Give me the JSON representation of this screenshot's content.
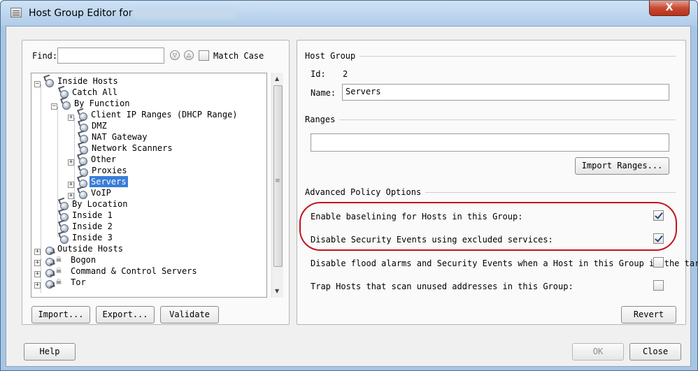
{
  "window": {
    "title": "Host Group Editor for",
    "close_label": "X"
  },
  "left": {
    "find_label": "Find:",
    "find_value": "",
    "match_case_label": "Match Case",
    "tree": [
      {
        "label": "Inside Hosts"
      },
      {
        "label": "Catch All"
      },
      {
        "label": "By Function"
      },
      {
        "label": "Client IP Ranges (DHCP Range)"
      },
      {
        "label": "DMZ"
      },
      {
        "label": "NAT Gateway"
      },
      {
        "label": "Network Scanners"
      },
      {
        "label": "Other"
      },
      {
        "label": "Proxies"
      },
      {
        "label": "Servers"
      },
      {
        "label": "VoIP"
      },
      {
        "label": "By Location"
      },
      {
        "label": "Inside 1"
      },
      {
        "label": "Inside 2"
      },
      {
        "label": "Inside 3"
      },
      {
        "label": "Outside Hosts"
      },
      {
        "label": "Bogon"
      },
      {
        "label": "Command & Control Servers"
      },
      {
        "label": "Tor"
      }
    ],
    "import_label": "Import...",
    "export_label": "Export...",
    "validate_label": "Validate"
  },
  "right": {
    "host_group_title": "Host Group",
    "id_label": "Id:",
    "id_value": "2",
    "name_label": "Name:",
    "name_value": "Servers",
    "ranges_title": "Ranges",
    "ranges_value": "",
    "import_ranges_label": "Import Ranges...",
    "advanced_title": "Advanced Policy Options",
    "options": [
      {
        "label": "Enable baselining for Hosts in this Group:",
        "checked": true
      },
      {
        "label": "Disable Security Events using excluded services:",
        "checked": true
      },
      {
        "label": "Disable flood alarms and Security Events when a Host in this Group is the target:",
        "checked": false
      },
      {
        "label": "Trap Hosts that scan unused addresses in this Group:",
        "checked": false
      }
    ],
    "revert_label": "Revert"
  },
  "footer": {
    "help_label": "Help",
    "ok_label": "OK",
    "close_label": "Close"
  },
  "colors": {
    "selection": "#3a7cd9",
    "highlight_oval": "#c0161c"
  }
}
